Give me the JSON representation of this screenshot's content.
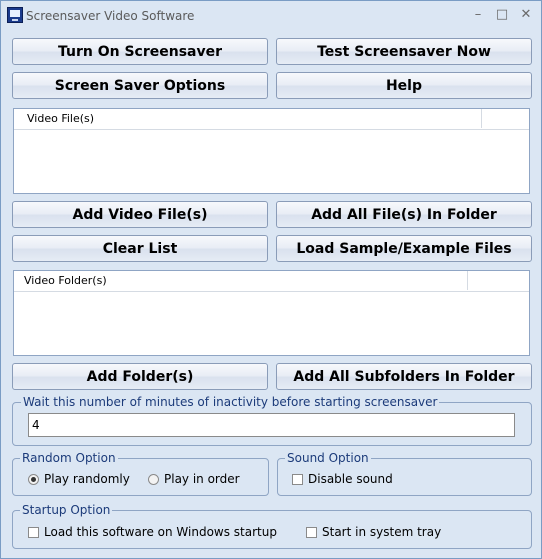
{
  "window": {
    "title": "Screensaver Video Software",
    "icon": "monitor-icon",
    "controls": {
      "minimize": "–",
      "maximize": "□",
      "close": "✕"
    }
  },
  "buttons": {
    "turn_on": "Turn On Screensaver",
    "test_now": "Test Screensaver Now",
    "options": "Screen Saver Options",
    "help": "Help",
    "add_video": "Add Video File(s)",
    "add_all_files": "Add All File(s) In Folder",
    "clear_list": "Clear List",
    "load_sample": "Load Sample/Example Files",
    "add_folder": "Add Folder(s)",
    "add_subfolders": "Add All Subfolders In Folder"
  },
  "video_files_list": {
    "column": "Video File(s)",
    "rows": []
  },
  "video_folders_list": {
    "column": "Video Folder(s)",
    "rows": []
  },
  "inactivity": {
    "label": "Wait this number of minutes of inactivity before starting screensaver",
    "value": "4"
  },
  "random_option": {
    "label": "Random Option",
    "play_randomly": "Play randomly",
    "play_in_order": "Play in order",
    "selected": "play_randomly"
  },
  "sound_option": {
    "label": "Sound Option",
    "disable_sound": "Disable sound",
    "disable_sound_checked": false
  },
  "startup_option": {
    "label": "Startup Option",
    "load_on_startup": "Load this software on Windows startup",
    "start_in_tray": "Start in system tray",
    "load_on_startup_checked": false,
    "start_in_tray_checked": false
  },
  "colors": {
    "window_bg": "#dbe6f3",
    "group_label": "#1c3b7a",
    "border": "#8fa5c4"
  }
}
